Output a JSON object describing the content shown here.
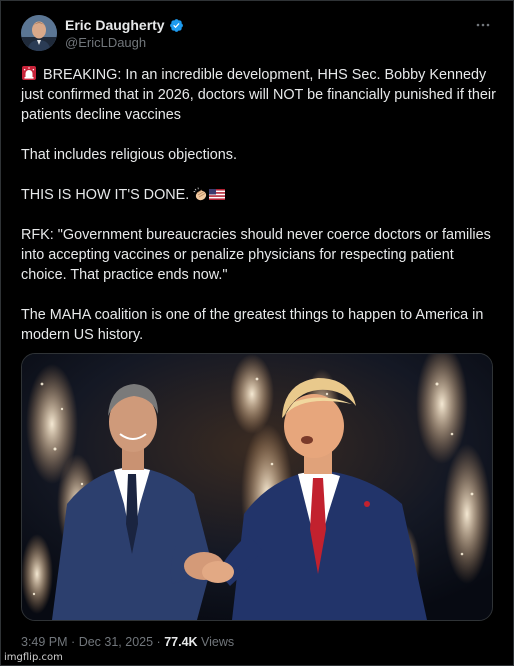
{
  "author": {
    "display_name": "Eric Daugherty",
    "handle": "@EricLDaugh",
    "verified": true
  },
  "post": {
    "paragraphs": [
      "BREAKING: In an incredible development, HHS Sec. Bobby Kennedy just confirmed that in 2026, doctors will NOT be financially punished if their patients decline vaccines",
      "That includes religious objections.",
      "THIS IS HOW IT'S DONE.",
      "RFK: \"Government bureaucracies should never coerce doctors or families into accepting vaccines or penalize physicians for respecting patient choice. That practice ends now.\"",
      "The MAHA coalition is one of the greatest things to happen to America in modern US history."
    ],
    "emoji_icons": [
      "rotating-light-icon",
      "clapping-hands-icon",
      "us-flag-icon"
    ]
  },
  "meta": {
    "time": "3:49 PM",
    "separator": "·",
    "date": "Dec 31, 2025",
    "views_count": "77.4K",
    "views_label": "Views"
  },
  "watermark": "imgflip.com",
  "colors": {
    "background": "#000000",
    "text": "#e7e9ea",
    "secondary": "#71767b",
    "verified": "#1d9bf0",
    "border": "#2f3336"
  }
}
